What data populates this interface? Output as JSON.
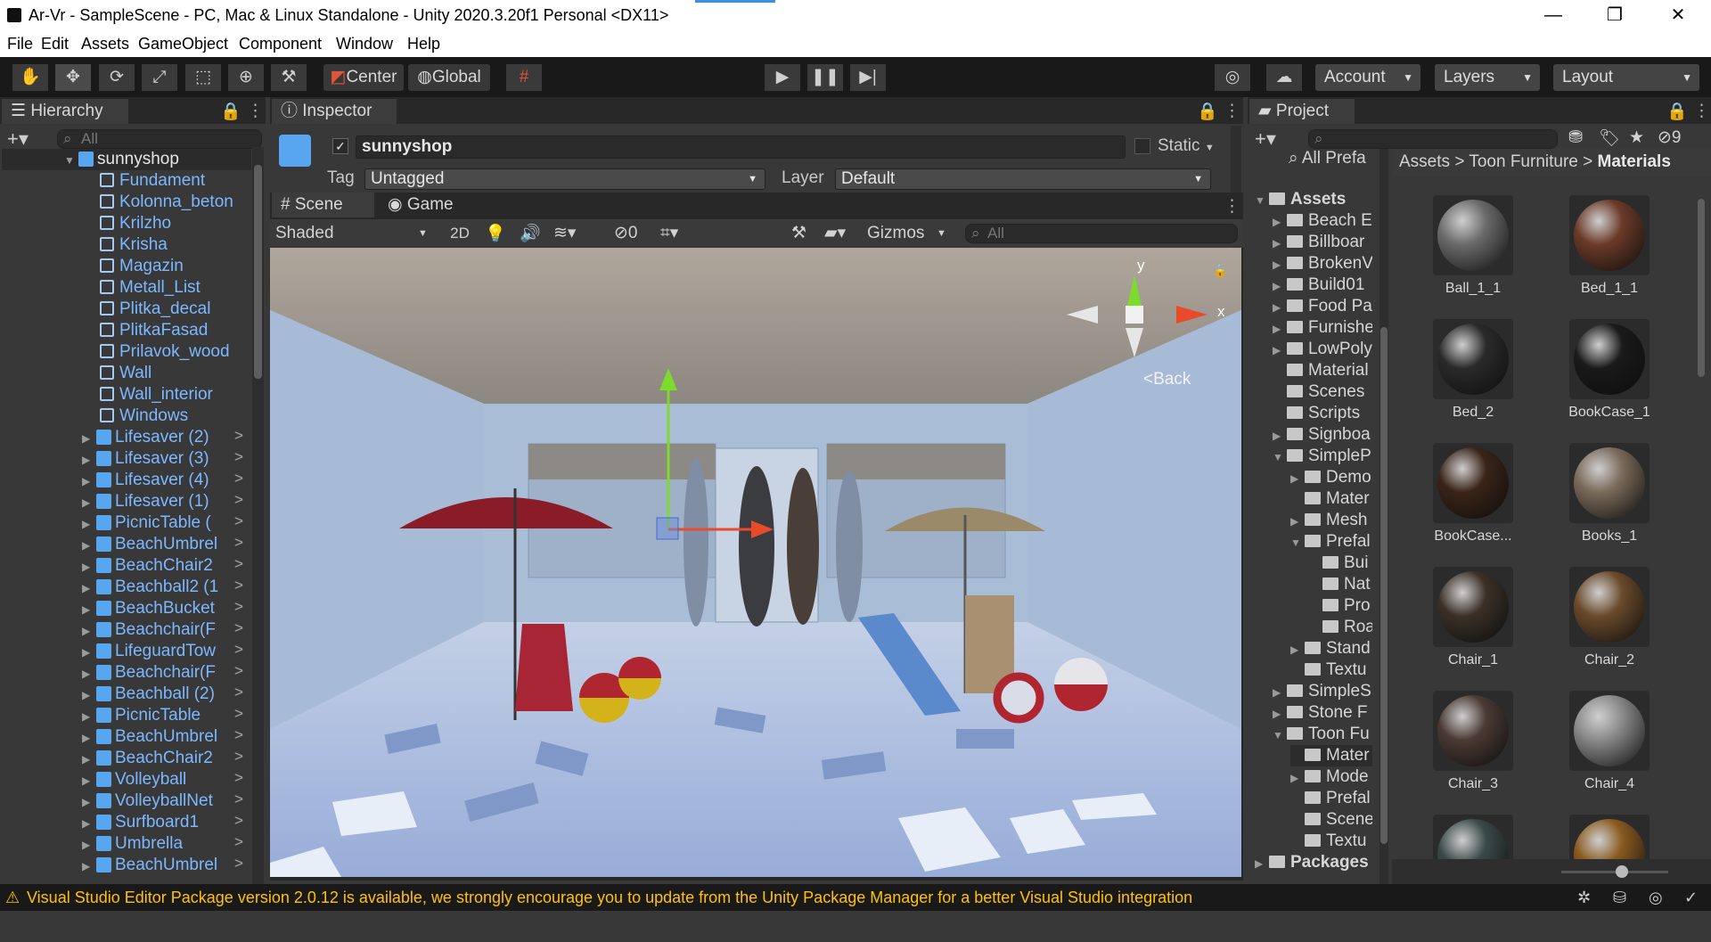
{
  "window": {
    "title": "Ar-Vr - SampleScene - PC, Mac & Linux Standalone - Unity 2020.3.20f1 Personal <DX11>",
    "minimize": "—",
    "restore": "❐",
    "close": "✕"
  },
  "menu": [
    "File",
    "Edit",
    "Assets",
    "GameObject",
    "Component",
    "Window",
    "Help"
  ],
  "toolbar": {
    "pivot": "Center",
    "space": "Global",
    "account": "Account",
    "layers": "Layers",
    "layout": "Layout"
  },
  "hierarchy": {
    "tab": "Hierarchy",
    "search_placeholder": "All",
    "root": "sunnyshop",
    "children": [
      "Fundament",
      "Kolonna_beton",
      "Krilzho",
      "Krisha",
      "Magazin",
      "Metall_List",
      "Plitka_decal",
      "PlitkaFasad",
      "Prilavok_wood",
      "Wall",
      "Wall_interior",
      "Windows"
    ],
    "prefabs": [
      "Lifesaver (2)",
      "Lifesaver (3)",
      "Lifesaver (4)",
      "Lifesaver (1)",
      "PicnicTable (",
      "BeachUmbrel",
      "BeachChair2",
      "Beachball2 (1",
      "BeachBucket",
      "Beachchair(F",
      "LifeguardTow",
      "Beachchair(F",
      "Beachball (2)",
      "PicnicTable",
      "BeachUmbrel",
      "BeachChair2",
      "Volleyball",
      "VolleyballNet",
      "Surfboard1",
      "Umbrella",
      "BeachUmbrel"
    ]
  },
  "inspector": {
    "tab": "Inspector",
    "object_name": "sunnyshop",
    "static_label": "Static",
    "tag_label": "Tag",
    "tag_value": "Untagged",
    "layer_label": "Layer",
    "layer_value": "Default"
  },
  "scene": {
    "tab_scene": "Scene",
    "tab_game": "Game",
    "shading": "Shaded",
    "mode_2d": "2D",
    "hidden_count": "0",
    "gizmos": "Gizmos",
    "search_placeholder": "All",
    "gizmo_y": "y",
    "gizmo_x": "x",
    "view_label": "Back"
  },
  "project": {
    "tab": "Project",
    "hidden_count": "9",
    "all_prefabs": "All Prefa",
    "breadcrumb": [
      "Assets",
      "Toon Furniture",
      "Materials"
    ],
    "tree": [
      {
        "label": "Assets",
        "indent": 0,
        "exp": "▼",
        "bold": true
      },
      {
        "label": "Beach E",
        "indent": 1,
        "exp": "▶"
      },
      {
        "label": "Billboar",
        "indent": 1,
        "exp": "▶"
      },
      {
        "label": "BrokenV",
        "indent": 1,
        "exp": "▶"
      },
      {
        "label": "Build01",
        "indent": 1,
        "exp": "▶"
      },
      {
        "label": "Food Pa",
        "indent": 1,
        "exp": "▶"
      },
      {
        "label": "Furnishe",
        "indent": 1,
        "exp": "▶"
      },
      {
        "label": "LowPoly",
        "indent": 1,
        "exp": "▶"
      },
      {
        "label": "Material",
        "indent": 1,
        "exp": ""
      },
      {
        "label": "Scenes",
        "indent": 1,
        "exp": ""
      },
      {
        "label": "Scripts",
        "indent": 1,
        "exp": ""
      },
      {
        "label": "Signboa",
        "indent": 1,
        "exp": "▶"
      },
      {
        "label": "SimpleP",
        "indent": 1,
        "exp": "▼"
      },
      {
        "label": "Demo",
        "indent": 2,
        "exp": "▶"
      },
      {
        "label": "Mater",
        "indent": 2,
        "exp": ""
      },
      {
        "label": "Mesh",
        "indent": 2,
        "exp": "▶"
      },
      {
        "label": "Prefal",
        "indent": 2,
        "exp": "▼"
      },
      {
        "label": "Bui",
        "indent": 3,
        "exp": ""
      },
      {
        "label": "Nat",
        "indent": 3,
        "exp": ""
      },
      {
        "label": "Pro",
        "indent": 3,
        "exp": ""
      },
      {
        "label": "Roa",
        "indent": 3,
        "exp": ""
      },
      {
        "label": "Stand",
        "indent": 2,
        "exp": "▶"
      },
      {
        "label": "Textu",
        "indent": 2,
        "exp": ""
      },
      {
        "label": "SimpleS",
        "indent": 1,
        "exp": "▶"
      },
      {
        "label": "Stone F",
        "indent": 1,
        "exp": "▶"
      },
      {
        "label": "Toon Fu",
        "indent": 1,
        "exp": "▼"
      },
      {
        "label": "Mater",
        "indent": 2,
        "exp": "",
        "selected": true
      },
      {
        "label": "Mode",
        "indent": 2,
        "exp": "▶"
      },
      {
        "label": "Prefal",
        "indent": 2,
        "exp": ""
      },
      {
        "label": "Scene",
        "indent": 2,
        "exp": ""
      },
      {
        "label": "Textu",
        "indent": 2,
        "exp": ""
      },
      {
        "label": "Packages",
        "indent": 0,
        "exp": "▶",
        "bold": true
      }
    ],
    "materials": [
      {
        "name": "Ball_1_1",
        "color": "#6a6a6a"
      },
      {
        "name": "Bed_1_1",
        "color": "#6b3a28"
      },
      {
        "name": "Bed_2",
        "color": "#2a2a2a"
      },
      {
        "name": "BookCase_1",
        "color": "#1a1a1a"
      },
      {
        "name": "BookCase...",
        "color": "#3a2418"
      },
      {
        "name": "Books_1",
        "color": "#7a6a5a"
      },
      {
        "name": "Chair_1",
        "color": "#3b3027"
      },
      {
        "name": "Chair_2",
        "color": "#6a4a2a"
      },
      {
        "name": "Chair_3",
        "color": "#4a3a34"
      },
      {
        "name": "Chair_4",
        "color": "#8a8a8a"
      },
      {
        "name": "",
        "color": "#3a4a48"
      },
      {
        "name": "",
        "color": "#8a5a20"
      }
    ]
  },
  "status": {
    "message": "Visual Studio Editor Package version 2.0.12 is available, we strongly encourage you to update from the Unity Package Manager for a better Visual Studio integration"
  }
}
